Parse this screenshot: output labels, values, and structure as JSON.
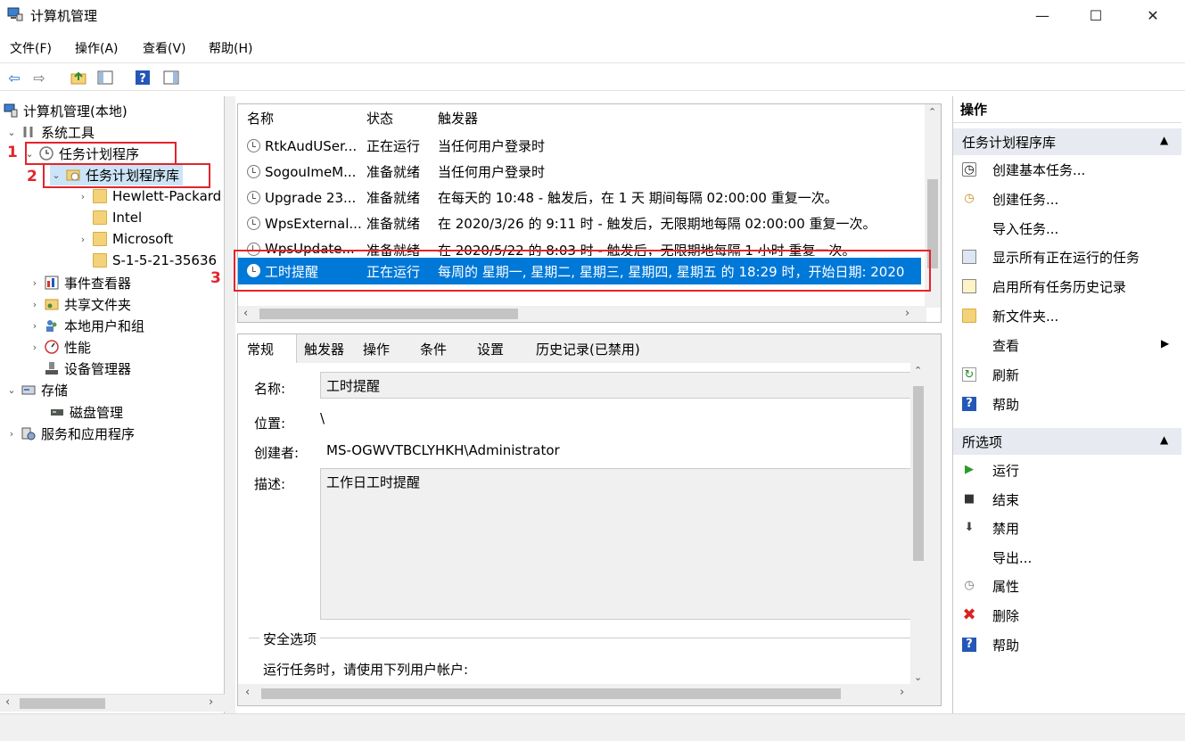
{
  "window": {
    "title": "计算机管理"
  },
  "menu": [
    "文件(F)",
    "操作(A)",
    "查看(V)",
    "帮助(H)"
  ],
  "tree": {
    "root": "计算机管理(本地)",
    "system_tools": "系统工具",
    "task_scheduler": "任务计划程序",
    "task_library": "任务计划程序库",
    "folders": [
      "Hewlett-Packard",
      "Intel",
      "Microsoft",
      "S-1-5-21-35636"
    ],
    "event_viewer": "事件查看器",
    "shared_folders": "共享文件夹",
    "local_users": "本地用户和组",
    "performance": "性能",
    "device_manager": "设备管理器",
    "storage": "存储",
    "disk_management": "磁盘管理",
    "services": "服务和应用程序"
  },
  "tasklist": {
    "headers": [
      "名称",
      "状态",
      "触发器"
    ],
    "rows": [
      {
        "name": "RtkAudUSer...",
        "status": "正在运行",
        "trigger": "当任何用户登录时"
      },
      {
        "name": "SogouImeM...",
        "status": "准备就绪",
        "trigger": "当任何用户登录时"
      },
      {
        "name": "Upgrade 23...",
        "status": "准备就绪",
        "trigger": "在每天的 10:48 - 触发后，在 1 天 期间每隔 02:00:00 重复一次。"
      },
      {
        "name": "WpsExternal...",
        "status": "准备就绪",
        "trigger": "在 2020/3/26 的 9:11 时 - 触发后，无限期地每隔 02:00:00 重复一次。"
      },
      {
        "name": "WpsUpdate...",
        "status": "准备就绪",
        "trigger": "在 2020/5/22 的 8:03 时 - 触发后，无限期地每隔 1 小时 重复一次。"
      },
      {
        "name": "工时提醒",
        "status": "正在运行",
        "trigger": "每周的 星期一, 星期二, 星期三, 星期四, 星期五 的 18:29 时，开始日期: 2020"
      }
    ]
  },
  "detail": {
    "tabs": [
      "常规",
      "触发器",
      "操作",
      "条件",
      "设置",
      "历史记录(已禁用)"
    ],
    "name_label": "名称:",
    "name_value": "工时提醒",
    "location_label": "位置:",
    "location_value": "\\",
    "author_label": "创建者:",
    "author_value": "MS-OGWVTBCLYHKH\\Administrator",
    "desc_label": "描述:",
    "desc_value": "工作日工时提醒",
    "security_label": "安全选项",
    "run_as_label": "运行任务时，请使用下列用户帐户:"
  },
  "actions": {
    "header": "操作",
    "section1": "任务计划程序库",
    "items1": [
      {
        "label": "创建基本任务...",
        "icon": "create-basic-task-icon"
      },
      {
        "label": "创建任务...",
        "icon": "create-task-icon"
      },
      {
        "label": "导入任务...",
        "icon": ""
      },
      {
        "label": "显示所有正在运行的任务",
        "icon": "running-tasks-icon"
      },
      {
        "label": "启用所有任务历史记录",
        "icon": "history-icon"
      },
      {
        "label": "新文件夹...",
        "icon": "new-folder-icon"
      },
      {
        "label": "查看",
        "icon": ""
      },
      {
        "label": "刷新",
        "icon": "refresh-icon"
      },
      {
        "label": "帮助",
        "icon": "help-icon"
      }
    ],
    "section2": "所选项",
    "items2": [
      {
        "label": "运行",
        "icon": "run-icon"
      },
      {
        "label": "结束",
        "icon": "end-icon"
      },
      {
        "label": "禁用",
        "icon": "disable-icon"
      },
      {
        "label": "导出...",
        "icon": ""
      },
      {
        "label": "属性",
        "icon": "properties-icon"
      },
      {
        "label": "删除",
        "icon": "delete-icon"
      },
      {
        "label": "帮助",
        "icon": "help-icon"
      }
    ]
  },
  "annotations": [
    "1",
    "2",
    "3"
  ],
  "colors": {
    "selection": "#0078d7",
    "annotation": "#e3242b",
    "section_header": "#e7eaf0"
  }
}
